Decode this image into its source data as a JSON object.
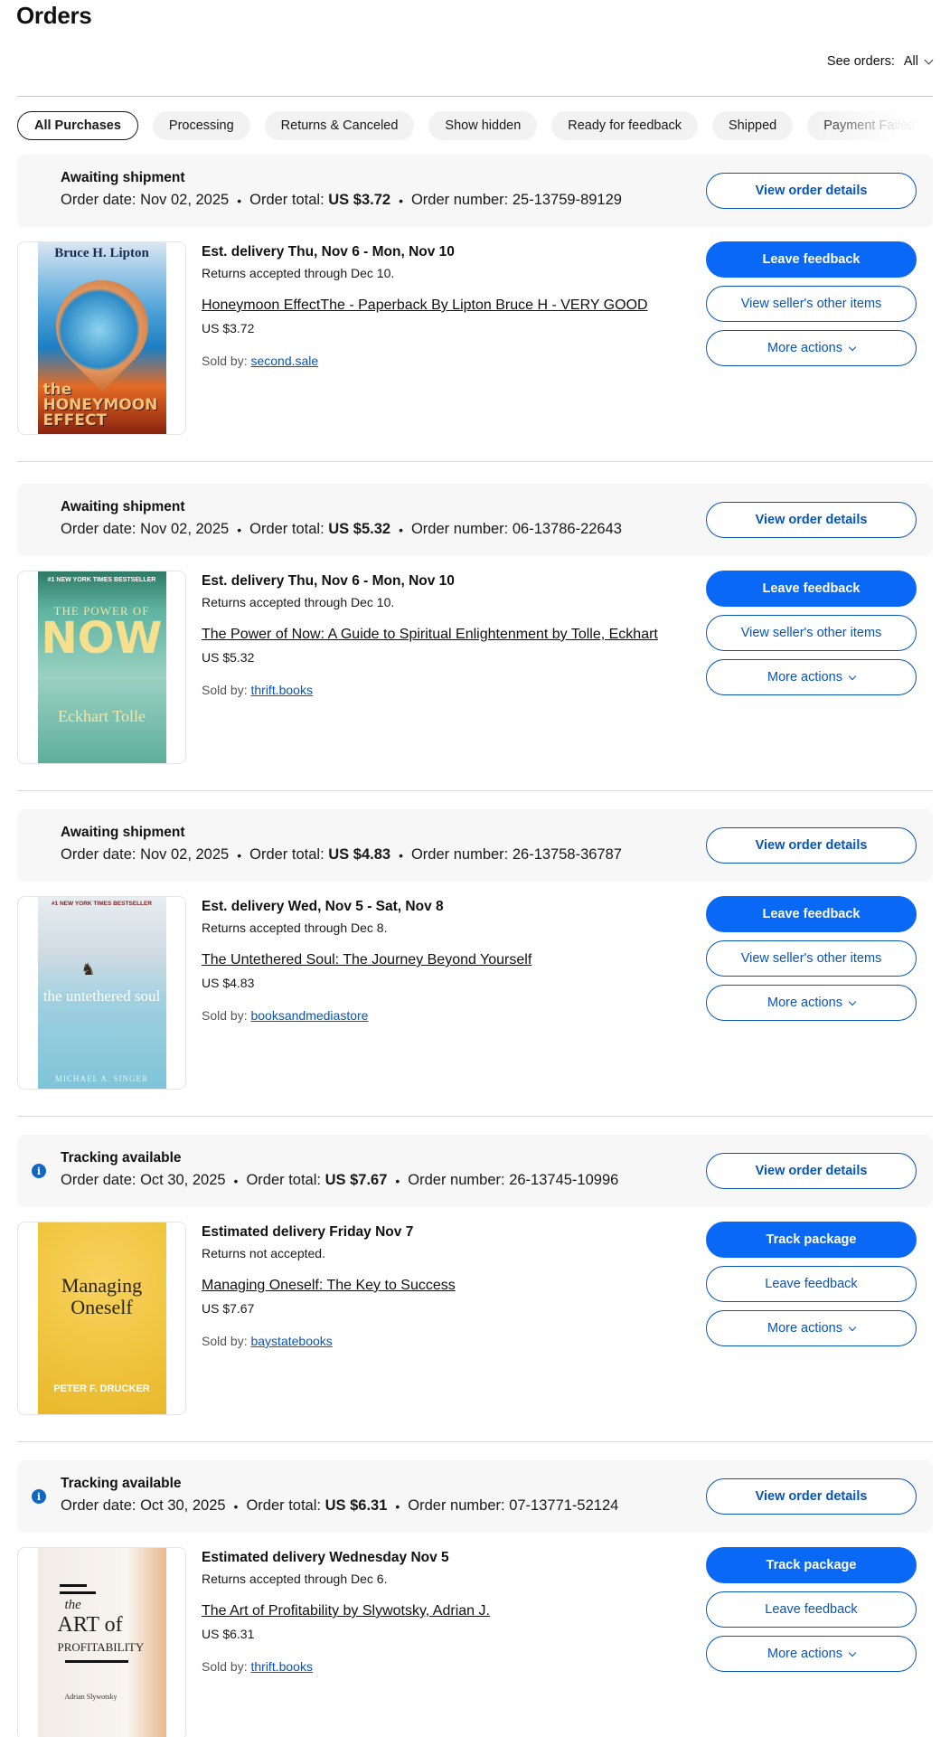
{
  "page": {
    "title": "Orders"
  },
  "see_orders": {
    "label": "See orders:",
    "value": "All"
  },
  "filters": [
    "All Purchases",
    "Processing",
    "Returns & Canceled",
    "Show hidden",
    "Ready for feedback",
    "Shipped",
    "Payment Failed"
  ],
  "labels": {
    "order_date": "Order date:",
    "order_total": "Order total:",
    "order_number": "Order number:",
    "sold_by": "Sold by:",
    "view_order_details": "View order details",
    "view_seller_items": "View seller's other items",
    "more_actions": "More actions",
    "leave_feedback": "Leave feedback",
    "track_package": "Track package"
  },
  "orders": [
    {
      "status": "Awaiting shipment",
      "order_date": "Nov 02, 2025",
      "order_total": "US $3.72",
      "order_number": "25-13759-89129",
      "delivery": "Est. delivery Thu, Nov 6 - Mon, Nov 10",
      "returns": "Returns accepted through Dec 10.",
      "title": "Honeymoon EffectThe - Paperback By Lipton Bruce H - VERY GOOD",
      "price": "US $3.72",
      "seller": "second.sale",
      "cover": {
        "author": "Bruce H. Lipton",
        "title_line1": "the",
        "title_line2": "HONEYMOON",
        "title_line3": "EFFECT"
      }
    },
    {
      "status": "Awaiting shipment",
      "order_date": "Nov 02, 2025",
      "order_total": "US $5.32",
      "order_number": "06-13786-22643",
      "delivery": "Est. delivery Thu, Nov 6 - Mon, Nov 10",
      "returns": "Returns accepted through Dec 10.",
      "title": "The Power of Now: A Guide to Spiritual Enlightenment by Tolle, Eckhart",
      "price": "US $5.32",
      "seller": "thrift.books",
      "cover": {
        "banner": "#1 NEW YORK TIMES BESTSELLER",
        "title_small": "THE POWER OF",
        "title_big": "NOW",
        "author": "Eckhart Tolle"
      }
    },
    {
      "status": "Awaiting shipment",
      "order_date": "Nov 02, 2025",
      "order_total": "US $4.83",
      "order_number": "26-13758-36787",
      "delivery": "Est. delivery Wed, Nov 5 - Sat, Nov 8",
      "returns": "Returns accepted through Dec 8.",
      "title": "The Untethered Soul: The Journey Beyond Yourself",
      "price": "US $4.83",
      "seller": "booksandmediastore",
      "cover": {
        "banner": "#1 NEW YORK TIMES BESTSELLER",
        "title": "the untethered soul",
        "author": "MICHAEL A. SINGER"
      }
    },
    {
      "status": "Tracking available",
      "order_date": "Oct 30, 2025",
      "order_total": "US $7.67",
      "order_number": "26-13745-10996",
      "delivery": "Estimated delivery Friday Nov 7",
      "returns": "Returns not accepted.",
      "title": "Managing Oneself: The Key to Success",
      "price": "US $7.67",
      "seller": "baystatebooks",
      "cover": {
        "title_line1": "Managing",
        "title_line2": "Oneself",
        "author": "PETER F. DRUCKER"
      }
    },
    {
      "status": "Tracking available",
      "order_date": "Oct 30, 2025",
      "order_total": "US $6.31",
      "order_number": "07-13771-52124",
      "delivery": "Estimated delivery Wednesday Nov 5",
      "returns": "Returns accepted through Dec 6.",
      "title": "The Art of Profitability by Slywotsky, Adrian J.",
      "price": "US $6.31",
      "seller": "thrift.books",
      "cover": {
        "t1": "the",
        "t2": "ART of",
        "t3": "PROFITABILITY",
        "author": "Adrian Slywotsky"
      }
    }
  ],
  "colors": {
    "primary": "#0968f6",
    "link": "#0654ba",
    "header_bg": "#f7f7f7",
    "info": "#1167c8"
  },
  "icons": {
    "info": "info-icon",
    "chevron": "chevron-down-icon"
  }
}
